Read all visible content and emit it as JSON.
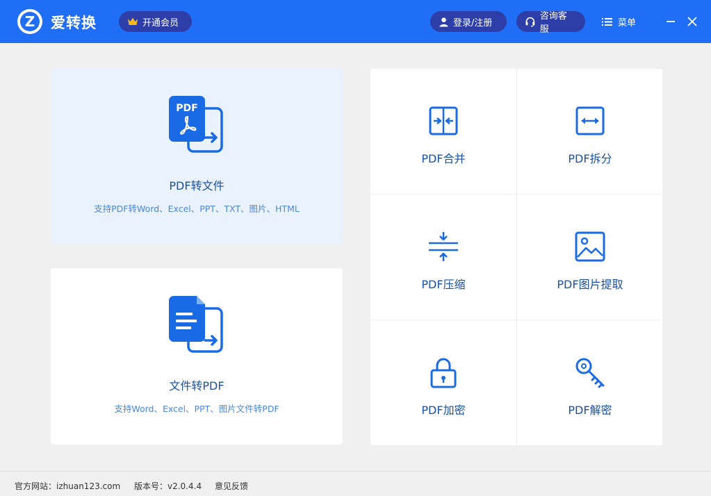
{
  "app": {
    "logo_letter": "Z",
    "title": "爱转换"
  },
  "header": {
    "vip_label": "开通会员",
    "login_label": "登录/注册",
    "service_label": "咨询客服",
    "menu_label": "菜单"
  },
  "cards": {
    "pdf_to_file": {
      "icon_text": "PDF",
      "title": "PDF转文件",
      "subtitle": "支持PDF转Word、Excel、PPT、TXT、图片、HTML"
    },
    "file_to_pdf": {
      "title": "文件转PDF",
      "subtitle": "支持Word、Excel、PPT、图片文件转PDF"
    }
  },
  "tools": [
    {
      "label": "PDF合并",
      "icon": "merge-icon"
    },
    {
      "label": "PDF拆分",
      "icon": "split-icon"
    },
    {
      "label": "PDF压缩",
      "icon": "compress-icon"
    },
    {
      "label": "PDF图片提取",
      "icon": "image-icon"
    },
    {
      "label": "PDF加密",
      "icon": "lock-icon"
    },
    {
      "label": "PDF解密",
      "icon": "key-icon"
    }
  ],
  "footer": {
    "site": "官方网站：izhuan123.com",
    "version": "版本号：v2.0.4.4",
    "feedback": "意见反馈"
  },
  "colors": {
    "header": "#1f6ef5",
    "pill": "#2d3ea8",
    "accent_text": "#1a4fa6",
    "sub_text": "#4a86e0",
    "icon_blue": "#1a6ae6"
  }
}
